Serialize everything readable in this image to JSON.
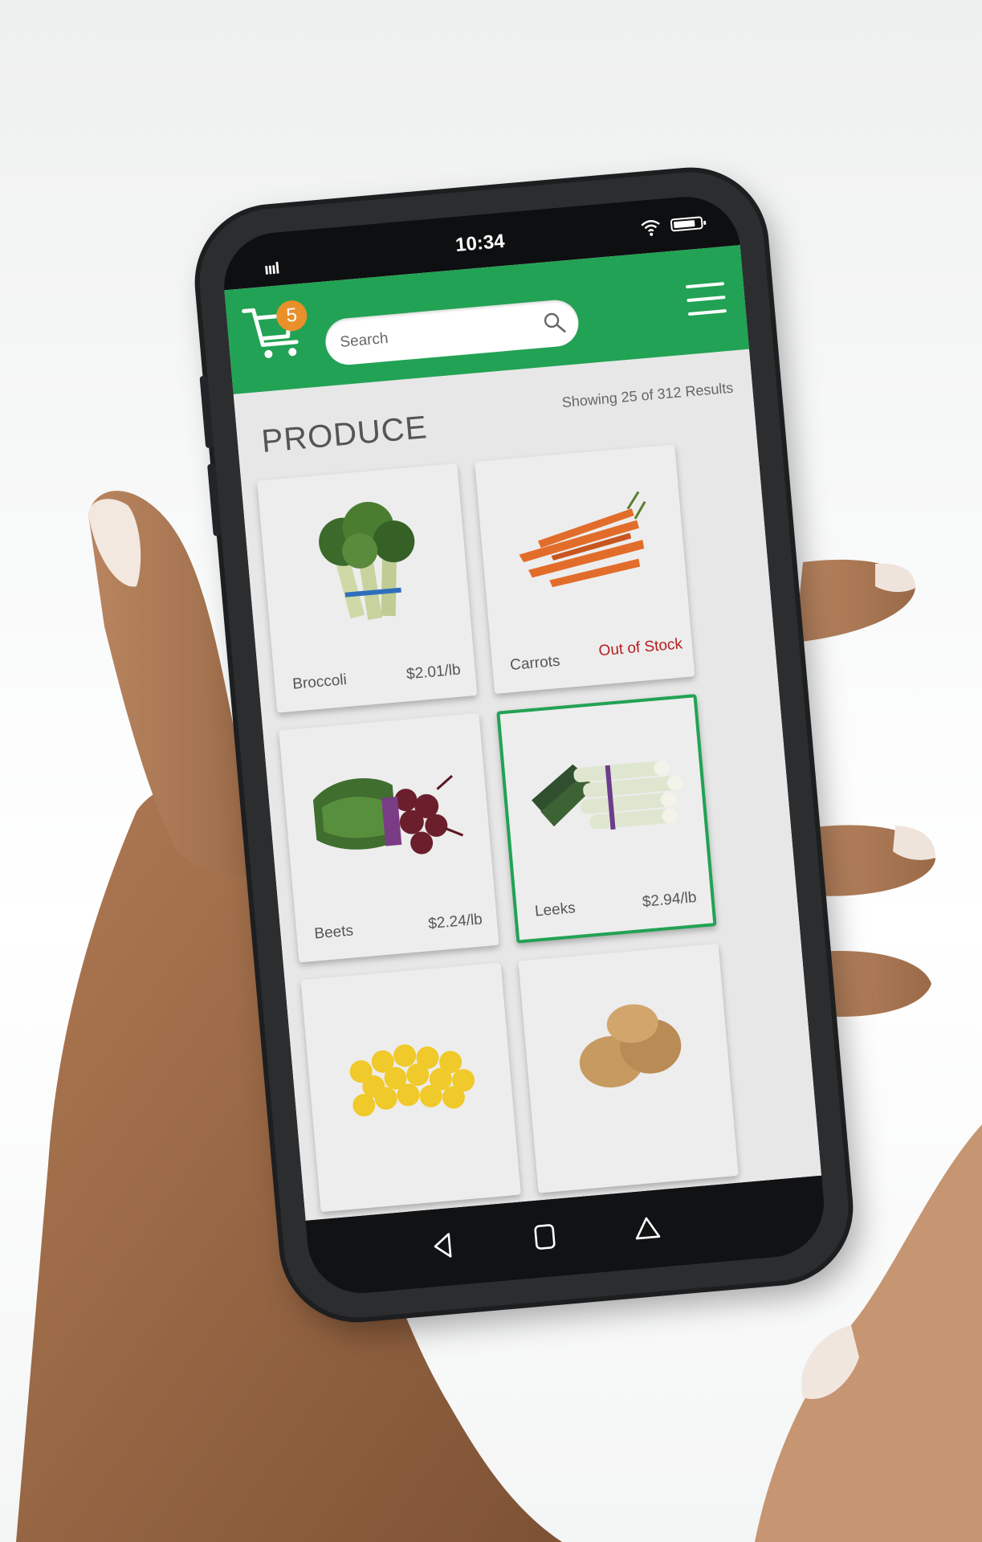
{
  "status": {
    "signal": "ıııl",
    "time": "10:34",
    "wifi_icon": "wifi-icon",
    "battery_icon": "battery-icon"
  },
  "header": {
    "cart_icon": "cart-icon",
    "cart_count": "5",
    "search_placeholder": "Search",
    "search_icon": "search-icon",
    "menu_icon": "menu-icon",
    "brand_color": "#22a254",
    "badge_color": "#e9902a"
  },
  "listing": {
    "title": "PRODUCE",
    "results_text": "Showing 25 of 312 Results"
  },
  "products": [
    {
      "name": "Broccoli",
      "price": "$2.01/lb",
      "stock": "",
      "image": "broccoli",
      "selected": false
    },
    {
      "name": "Carrots",
      "price": "",
      "stock": "Out of Stock",
      "image": "carrots",
      "selected": false
    },
    {
      "name": "Beets",
      "price": "$2.24/lb",
      "stock": "",
      "image": "beets",
      "selected": false
    },
    {
      "name": "Leeks",
      "price": "$2.94/lb",
      "stock": "",
      "image": "leeks",
      "selected": true
    },
    {
      "name": "",
      "price": "",
      "stock": "",
      "image": "lemons",
      "selected": false
    },
    {
      "name": "",
      "price": "",
      "stock": "",
      "image": "potatoes",
      "selected": false
    }
  ],
  "navigation": {
    "back_icon": "back-icon",
    "home_icon": "home-icon",
    "recents_icon": "recents-icon"
  }
}
